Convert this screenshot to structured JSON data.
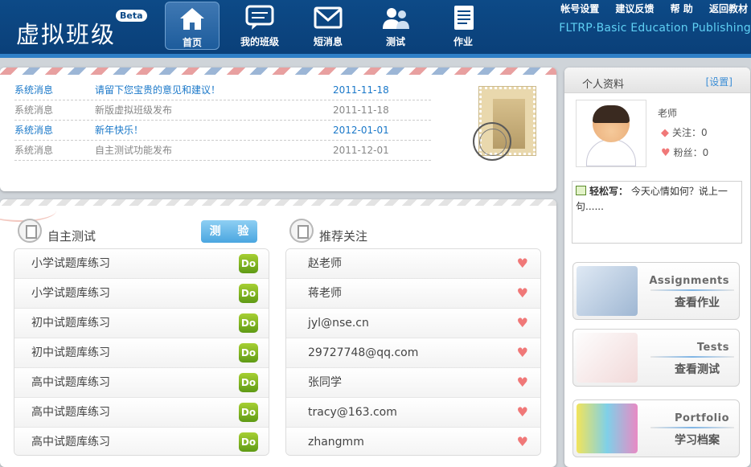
{
  "header": {
    "logo": "虚拟班级",
    "beta": "Beta",
    "nav": [
      {
        "label": "首页",
        "icon": "home-icon",
        "active": true
      },
      {
        "label": "我的班级",
        "icon": "chat-bubble-icon",
        "active": false
      },
      {
        "label": "短消息",
        "icon": "envelope-icon",
        "active": false
      },
      {
        "label": "测试",
        "icon": "people-icon",
        "active": false
      },
      {
        "label": "作业",
        "icon": "document-icon",
        "active": false
      }
    ],
    "links": [
      "帐号设置",
      "建议反馈",
      "帮 助",
      "返回教材"
    ],
    "brand": "FLTRP·Basic Education Publishing"
  },
  "messages": [
    {
      "type": "系统消息",
      "text": "请留下您宝贵的意见和建议！",
      "date": "2011-11-18",
      "highlight": true
    },
    {
      "type": "系统消息",
      "text": "新版虚拟班级发布",
      "date": "2011-11-18",
      "highlight": false
    },
    {
      "type": "系统消息",
      "text": "新年快乐！",
      "date": "2012-01-01",
      "highlight": true
    },
    {
      "type": "系统消息",
      "text": "自主测试功能发布",
      "date": "2011-12-01",
      "highlight": false
    }
  ],
  "self_test": {
    "title": "自主测试",
    "button": "测 验",
    "do_label": "Do",
    "items": [
      "小学试题库练习",
      "小学试题库练习",
      "初中试题库练习",
      "初中试题库练习",
      "高中试题库练习",
      "高中试题库练习",
      "高中试题库练习"
    ]
  },
  "recommend": {
    "title": "推荐关注",
    "items": [
      "赵老师",
      "蒋老师",
      "jyl@nse.cn",
      "29727748@qq.com",
      "张同学",
      "tracy@163.com",
      "zhangmm"
    ]
  },
  "profile": {
    "title": "个人资料",
    "settings": "[设置]",
    "name": "老师",
    "follow": "关注：0",
    "fans": "粉丝：0",
    "compose_label": "轻松写：",
    "compose_text": "今天心情如何？说上一句......"
  },
  "cards": [
    {
      "en": "Assignments",
      "cn": "查看作业"
    },
    {
      "en": "Tests",
      "cn": "查看测试"
    },
    {
      "en": "Portfolio",
      "cn": "学习档案"
    }
  ],
  "colors": {
    "header": "#0d4a87",
    "link": "#1a78c9",
    "do": "#6fa81f",
    "heart": "#f07878"
  }
}
